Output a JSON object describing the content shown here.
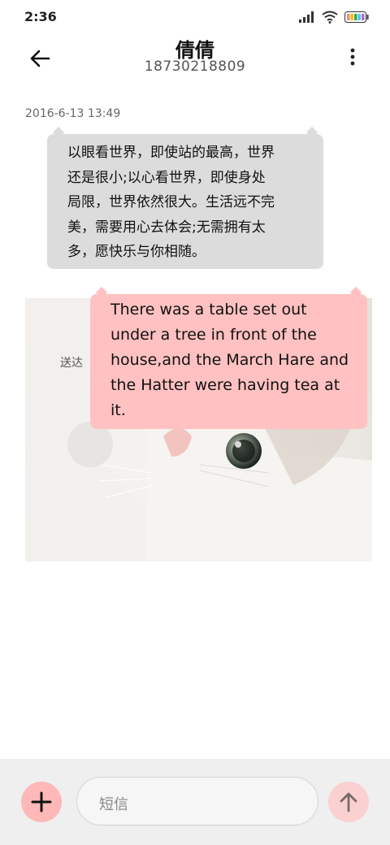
{
  "status_bar": {
    "time": "2:36"
  },
  "header": {
    "title": "倩倩",
    "subtitle": "18730218809"
  },
  "messages": {
    "timestamp": "2016-6-13 13:49",
    "incoming_lines": [
      "以眼看世界，即使站的最高，世界",
      "还是很小;以心看世界，即使身处",
      "局限，世界依然很大。生活远不完",
      "美，需要用心去体会;无需拥有太",
      "多，愿快乐与你相随。"
    ],
    "outgoing_lines": [
      "There was a table set out",
      "under a tree in front of the",
      "house,and the March Hare and",
      "the Hatter were having tea at",
      "it."
    ],
    "status": "送达"
  },
  "composer": {
    "placeholder": "短信"
  },
  "colors": {
    "incoming_bubble": "#dcdcdc",
    "outgoing_bubble": "#ffc1c1",
    "accent_button": "#ffb8b8"
  },
  "icons": [
    "signal-icon",
    "wifi-icon",
    "battery-icon",
    "back-arrow-icon",
    "more-icon",
    "plus-icon",
    "send-arrow-icon"
  ]
}
